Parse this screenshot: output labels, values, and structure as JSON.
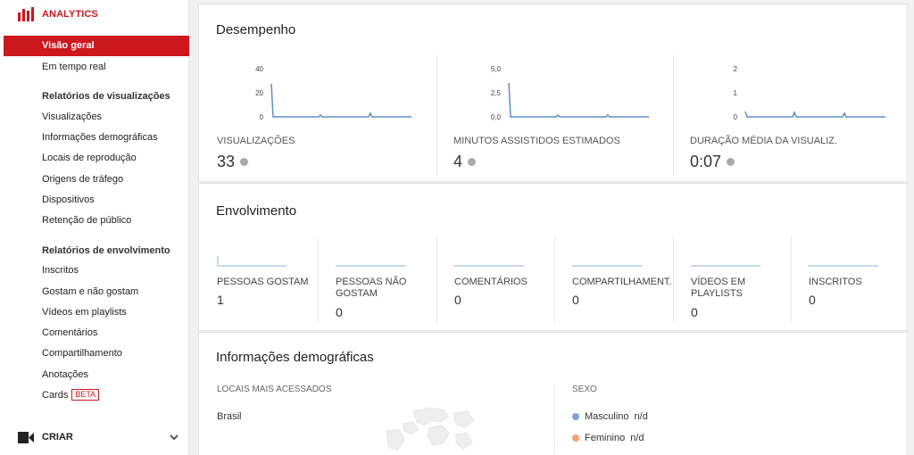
{
  "colors": {
    "brand": "#cc181e",
    "chart_line": "#5b8fc7",
    "male": "#7ba3d6",
    "female": "#f0a07a"
  },
  "sidebar": {
    "brand": "ANALYTICS",
    "active_item": "Visão geral",
    "item_realtime": "Em tempo real",
    "section_views": "Relatórios de visualizações",
    "views_items": [
      "Visualizações",
      "Informações demográficas",
      "Locais de reprodução",
      "Origens de tráfego",
      "Dispositivos",
      "Retenção de público"
    ],
    "section_engagement": "Relatórios de envolvimento",
    "engagement_items": [
      "Inscritos",
      "Gostam e não gostam",
      "Vídeos em playlists",
      "Comentários",
      "Compartilhamento",
      "Anotações"
    ],
    "cards_label": "Cards",
    "cards_badge": "BETA",
    "criar": "CRIAR"
  },
  "performance": {
    "title": "Desempenho",
    "metrics": [
      {
        "label": "VISUALIZAÇÕES",
        "value": "33",
        "yticks": [
          "40",
          "20",
          "0"
        ]
      },
      {
        "label": "MINUTOS ASSISTIDOS ESTIMADOS",
        "value": "4",
        "yticks": [
          "5,0",
          "2,5",
          "0,0"
        ]
      },
      {
        "label": "DURAÇÃO MÉDIA DA VISUALIZ.",
        "value": "0:07",
        "yticks": [
          "2",
          "1",
          "0"
        ]
      }
    ]
  },
  "engagement": {
    "title": "Envolvimento",
    "metrics": [
      {
        "label": "PESSOAS GOSTAM",
        "value": "1"
      },
      {
        "label": "PESSOAS NÃO GOSTAM",
        "value": "0"
      },
      {
        "label": "COMENTÁRIOS",
        "value": "0"
      },
      {
        "label": "COMPARTILHAMENT.",
        "value": "0"
      },
      {
        "label": "VÍDEOS EM PLAYLISTS",
        "value": "0"
      },
      {
        "label": "INSCRITOS",
        "value": "0"
      }
    ]
  },
  "demographics": {
    "title": "Informações demográficas",
    "locations_header": "LOCAIS MAIS ACESSADOS",
    "top_location": "Brasil",
    "sex_header": "SEXO",
    "male_label": "Masculino",
    "male_value": "n/d",
    "female_label": "Feminino",
    "female_value": "n/d"
  }
}
